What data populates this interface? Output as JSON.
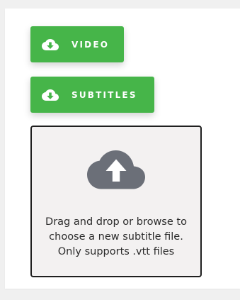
{
  "buttons": {
    "video": {
      "label": "VIDEO",
      "icon": "cloud-download-icon"
    },
    "subtitles": {
      "label": "SUBTITLES",
      "icon": "cloud-download-icon"
    }
  },
  "dropzone": {
    "icon": "cloud-upload-icon",
    "lines": [
      "Drag and drop or browse to",
      "choose a new subtitle file.",
      "Only supports .vtt files"
    ]
  },
  "colors": {
    "button_green": "#46b549",
    "icon_gray": "#6b6f78",
    "dropzone_bg": "#f3f1f1"
  }
}
